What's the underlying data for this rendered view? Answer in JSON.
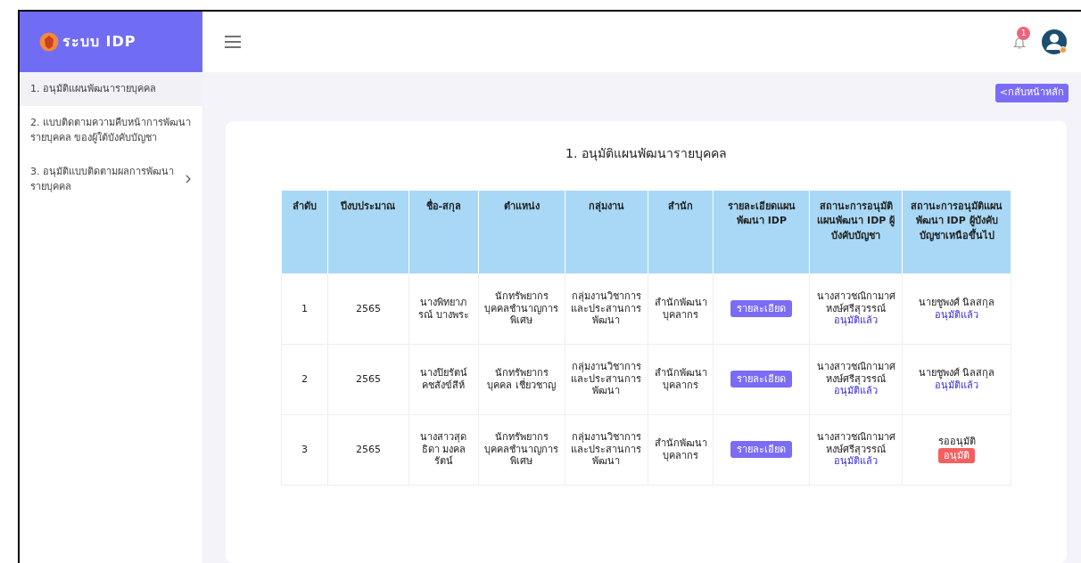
{
  "brand": {
    "title": "ระบบ IDP"
  },
  "header": {
    "notification_count": "1"
  },
  "sidebar": {
    "items": [
      {
        "label": "1. อนุมัติแผนพัฒนารายบุคคล",
        "selected": true,
        "expandable": false
      },
      {
        "label": "2. แบบติดตามความคืบหน้าการพัฒนารายบุคคล ของผู้ใต้บังคับบัญชา",
        "selected": false,
        "expandable": false
      },
      {
        "label": "3. อนุมัติแบบติดตามผลการพัฒนารายบุคคล",
        "selected": false,
        "expandable": true
      }
    ]
  },
  "back_button": "<กลับหน้าหลัก",
  "page_title": "1. อนุมัติแผนพัฒนารายบุคคล",
  "table": {
    "columns": [
      "ลำดับ",
      "ปีงบประมาณ",
      "ชื่อ-สกุล",
      "ตำแหน่ง",
      "กลุ่มงาน",
      "สำนัก",
      "รายละเอียดแผนพัฒนา IDP",
      "สถานะการอนุมัติแผนพัฒนา IDP ผู้บังคับบัญชา",
      "สถานะการอนุมัติแผนพัฒนา IDP ผู้บังคับบัญชาเหนือขึ้นไป"
    ],
    "rows": [
      {
        "no": "1",
        "year": "2565",
        "name": "นางพิทยาภรณ์ บางพระ",
        "position": "นักทรัพยากรบุคคลชำนาญการพิเศษ",
        "group": "กลุ่มงานวิชาการและประสานการพัฒนา",
        "office": "สำนักพัฒนาบุคลากร",
        "detail_button": "รายละเอียด",
        "supervisor": {
          "name": "นางสาวชณิกามาศ หงษ์ศรีสุวรรณ์",
          "status": "อนุมัติแล้ว"
        },
        "senior": {
          "kind": "approved",
          "name": "นายชูพงศ์ นิลสกุล",
          "status": "อนุมัติแล้ว"
        }
      },
      {
        "no": "2",
        "year": "2565",
        "name": "นางปิยรัตน์ คชสังข์สีห์",
        "position": "นักทรัพยากรบุคคล เชี่ยวชาญ",
        "group": "กลุ่มงานวิชาการและประสานการพัฒนา",
        "office": "สำนักพัฒนาบุคลากร",
        "detail_button": "รายละเอียด",
        "supervisor": {
          "name": "นางสาวชณิกามาศ หงษ์ศรีสุวรรณ์",
          "status": "อนุมัติแล้ว"
        },
        "senior": {
          "kind": "approved",
          "name": "นายชูพงศ์ นิลสกุล",
          "status": "อนุมัติแล้ว"
        }
      },
      {
        "no": "3",
        "year": "2565",
        "name": "นางสาวสุดธิดา มงคลรัตน์",
        "position": "นักทรัพยากรบุคคลชำนาญการพิเศษ",
        "group": "กลุ่มงานวิชาการและประสานการพัฒนา",
        "office": "สำนักพัฒนาบุคลากร",
        "detail_button": "รายละเอียด",
        "supervisor": {
          "name": "นางสาวชณิกามาศ หงษ์ศรีสุวรรณ์",
          "status": "อนุมัติแล้ว"
        },
        "senior": {
          "kind": "pending",
          "status": "รออนุมัติ",
          "action": "อนุมัติ"
        }
      }
    ]
  }
}
